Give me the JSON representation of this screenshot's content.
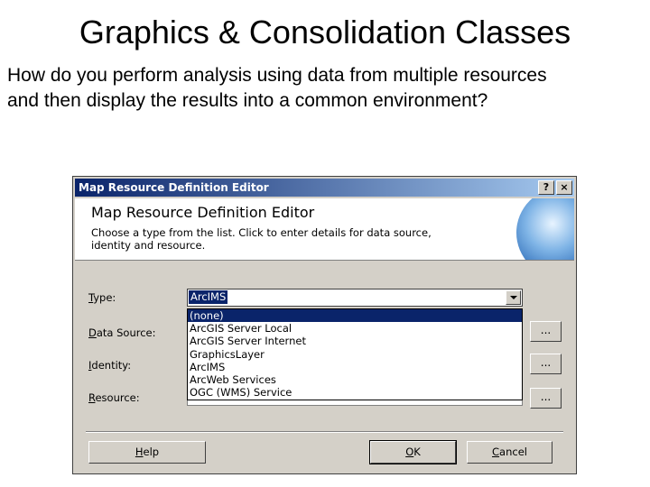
{
  "slide": {
    "title": "Graphics & Consolidation Classes",
    "question_line1": "How do you perform analysis using data from multiple resources",
    "question_line2": "and then display the results into a common environment?"
  },
  "dialog": {
    "window_title": "Map Resource Definition Editor",
    "help_glyph": "?",
    "close_glyph": "×",
    "header_title": "Map Resource Definition Editor",
    "header_desc_line1": "Choose a type from the list. Click to enter details for data source,",
    "header_desc_line2": "identity and resource.",
    "labels": {
      "type_key": "T",
      "type_rest": "ype:",
      "data_source_key": "D",
      "data_source_rest": "ata Source:",
      "identity_key": "I",
      "identity_rest": "dentity:",
      "resource_key": "R",
      "resource_rest": "esource:"
    },
    "type_value": "ArcIMS",
    "dropdown_options": [
      "(none)",
      "ArcGIS Server Local",
      "ArcGIS Server Internet",
      "GraphicsLayer",
      "ArcIMS",
      "ArcWeb Services",
      "OGC (WMS) Service"
    ],
    "browse_label": "...",
    "help_key": "H",
    "help_rest": "elp",
    "ok_key": "O",
    "ok_rest": "K",
    "cancel_key": "C",
    "cancel_rest": "ancel"
  },
  "colors": {
    "titlebar": "#0a246a",
    "dialog_face": "#d4d0c8",
    "selection": "#0a246a"
  }
}
